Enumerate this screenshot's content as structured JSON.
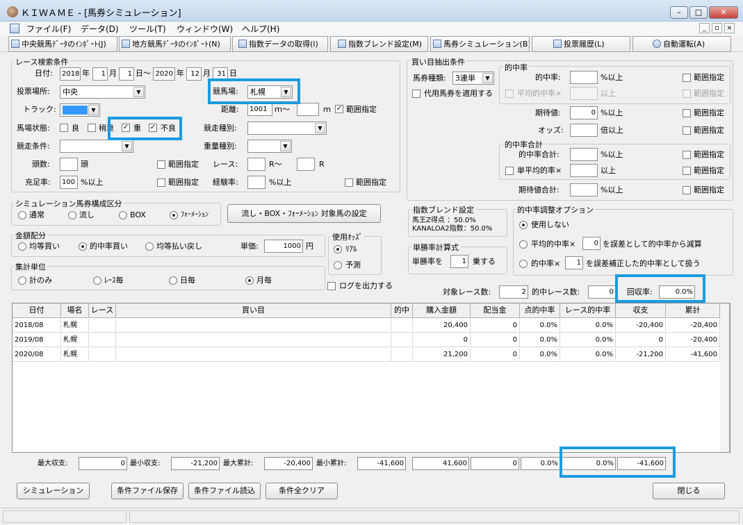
{
  "window": {
    "title": "ＫＩＷＡＭＥ - [馬券シミュレーション]",
    "minimize": "–",
    "maximize": "□",
    "close": "✕"
  },
  "menu": [
    "ファイル(F)",
    "データ(D)",
    "ツール(T)",
    "ウィンドウ(W)",
    "ヘルプ(H)"
  ],
  "mdi": {
    "minimize": "_",
    "restore": "▫",
    "close": "×"
  },
  "toolbar": [
    "中央競馬ﾃﾞｰﾀのｲﾝﾎﾟｰﾄ(J)",
    "地方競馬ﾃﾞｰﾀのｲﾝﾎﾟｰﾄ(N)",
    "指数データの取得(I)",
    "指数ブレンド設定(M)",
    "馬券シミュレーション(B)",
    "投票履歴(L)",
    "自動運転(A)"
  ],
  "search": {
    "title": "レース検索条件",
    "date_label": "日付:",
    "start_year": "2018",
    "year1": "年",
    "start_month": "1",
    "month1": "月",
    "start_day": "1",
    "day1": "日～",
    "end_year": "2020",
    "year2": "年",
    "end_month": "12",
    "month2": "月",
    "end_day": "31",
    "day2": "日",
    "venue_label": "投票場所:",
    "venue_value": "中央",
    "course_label": "競馬場:",
    "course_value": "札幌",
    "track_label": "トラック:",
    "distance_label": "距離:",
    "distance_from": "1001",
    "distance_unit1": "ｍ～",
    "distance_to": "",
    "distance_unit2": "ｍ",
    "distance_range": "範囲指定",
    "condition_label": "馬場状態:",
    "cond_good": "良",
    "cond_slight": "稍重",
    "cond_heavy": "重",
    "cond_bad": "不良",
    "race_type_label": "競走種別:",
    "race_cond_label": "競走条件:",
    "weight_label": "重量種別:",
    "heads_label": "頭数:",
    "heads_unit": "頭",
    "heads_range": "範囲指定",
    "race_label": "レース:",
    "race_unit1": "R～",
    "race_unit2": "R",
    "fill_label": "充足率:",
    "fill_value": "100",
    "fill_unit": "%以上",
    "fill_range": "範囲指定",
    "exp_label": "経験率:",
    "exp_unit": "%以上",
    "exp_range": "範囲指定"
  },
  "buy": {
    "title": "買い目抽出条件",
    "ticket_label": "馬券種類:",
    "ticket_value": "3連単",
    "proxy_label": "代用馬券を適用する",
    "hit_group": "的中率",
    "hit_label": "的中率:",
    "hit_unit": "%以上",
    "hit_range": "範囲指定",
    "avg_hit_label": "平均的中率×",
    "avg_unit": "以上",
    "avg_range": "範囲指定",
    "ev_label": "期待値:",
    "ev_value": "0",
    "ev_unit": "%以上",
    "ev_range": "範囲指定",
    "odds_label": "オッズ:",
    "odds_unit": "倍以上",
    "odds_range": "範囲指定",
    "sum_group": "的中率合計",
    "sum_label": "的中率合計:",
    "sum_unit": "%以上",
    "sum_range": "範囲指定",
    "single_avg_label": "単平均的率×",
    "single_unit": "以上",
    "single_range": "範囲指定",
    "ev_sum_label": "期待値合計:",
    "ev_sum_unit": "%以上",
    "ev_sum_range": "範囲指定"
  },
  "sim": {
    "title": "シミュレーション馬券構成区分",
    "normal": "通常",
    "nagashi": "流し",
    "box": "BOX",
    "formation": "ﾌｫｰﾒｰｼｮﾝ",
    "set_button": "流し・BOX・ﾌｫｰﾒｰｼｮﾝ 対象馬の設定"
  },
  "blend": {
    "title": "指数ブレンド設定",
    "line1": "馬王Z得点 ：50.0%",
    "line2": "KANALOA2指数：50.0%"
  },
  "adjust": {
    "title": "的中率調整オプション",
    "opt1": "使用しない",
    "opt2a": "平均的中率×",
    "opt2_value": "0",
    "opt2b": "を誤差として的中率から減算",
    "opt3a": "的中率×",
    "opt3_value": "1",
    "opt3b": "を誤差補正した的中率として扱う"
  },
  "money": {
    "title": "金額配分",
    "equal_buy": "均等買い",
    "hit_buy": "的中率買い",
    "equal_pay": "均等払い戻し",
    "unit_label": "単価:",
    "unit_value": "1000",
    "unit_yen": "円"
  },
  "odds_use": {
    "title": "使用ｵｯｽﾞ",
    "real": "ﾘｱﾙ",
    "forecast": "予測"
  },
  "win": {
    "title": "単勝率計算式",
    "label": "単勝率を",
    "value": "1",
    "unit": "乗する"
  },
  "agg": {
    "title": "集計単位",
    "total": "計のみ",
    "per_race": "ﾚｰｽ毎",
    "daily": "日毎",
    "monthly": "月毎"
  },
  "log_label": "ログを出力する",
  "summary": {
    "races_label": "対象レース数:",
    "races_value": "2",
    "hits_label": "的中レース数:",
    "hits_value": "0",
    "return_label": "回収率:",
    "return_value": "0.0%"
  },
  "table": {
    "headers": [
      "日付",
      "場名",
      "レース",
      "買い目",
      "的中",
      "購入金額",
      "配当金",
      "点的中率",
      "レース的中率",
      "収支",
      "累計"
    ],
    "rows": [
      [
        "2018/08",
        "札幌",
        "",
        "",
        "",
        "20,400",
        "0",
        "0.0%",
        "0.0%",
        "-20,400",
        "-20,400"
      ],
      [
        "2019/08",
        "札幌",
        "",
        "",
        "",
        "0",
        "0",
        "0.0%",
        "0.0%",
        "0",
        "-20,400"
      ],
      [
        "2020/08",
        "札幌",
        "",
        "",
        "",
        "21,200",
        "0",
        "0.0%",
        "0.0%",
        "-21,200",
        "-41,600"
      ]
    ]
  },
  "footer": {
    "max_label": "最大収支:",
    "max_value": "0",
    "min_label": "最小収支:",
    "min_value": "-21,200",
    "max_cum_label": "最大累計:",
    "max_cum_value": "-20,400",
    "min_cum_label": "最小累計:",
    "min_cum_value": "-41,600",
    "buy_total": "41,600",
    "pay_total": "0",
    "hit_rate": "0.0%",
    "race_hit": "0.0%",
    "cum_total": "-41,600"
  },
  "buttons": {
    "simulate": "シミュレーション",
    "save": "条件ファイル保存",
    "load": "条件ファイル読込",
    "clear": "条件全クリア",
    "close": "閉じる"
  },
  "colors": {
    "highlight": "#1a9be0",
    "track_swatch": "#3399ff"
  }
}
